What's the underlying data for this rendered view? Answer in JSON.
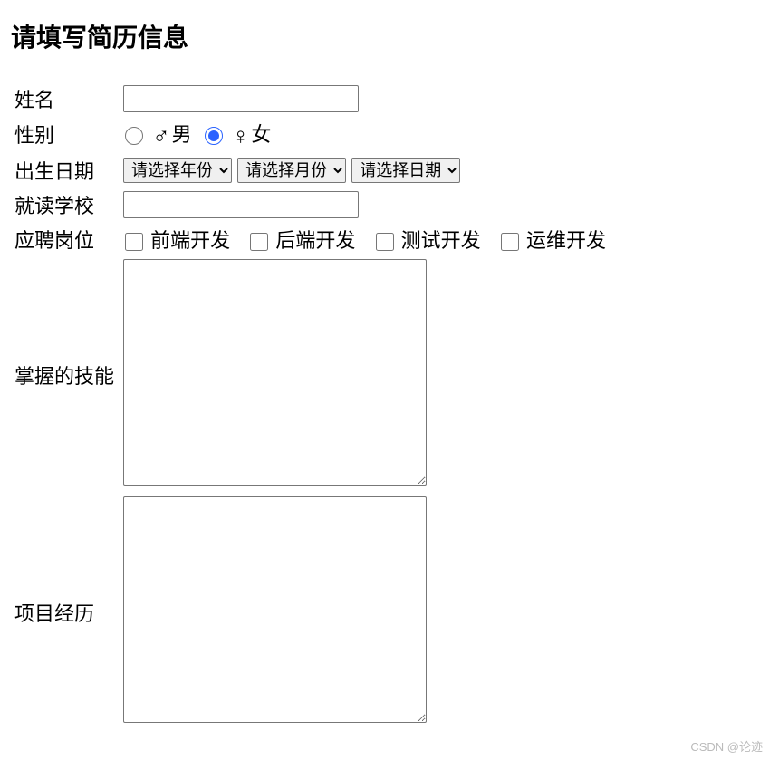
{
  "title": "请填写简历信息",
  "fields": {
    "name": {
      "label": "姓名",
      "value": ""
    },
    "gender": {
      "label": "性别",
      "options": [
        {
          "symbol": "♂",
          "text": "男",
          "checked": false
        },
        {
          "symbol": "♀",
          "text": "女",
          "checked": true
        }
      ]
    },
    "birth": {
      "label": "出生日期",
      "year": {
        "placeholder": "请选择年份"
      },
      "month": {
        "placeholder": "请选择月份"
      },
      "day": {
        "placeholder": "请选择日期"
      }
    },
    "school": {
      "label": "就读学校",
      "value": ""
    },
    "position": {
      "label": "应聘岗位",
      "options": [
        {
          "text": "前端开发",
          "checked": false
        },
        {
          "text": "后端开发",
          "checked": false
        },
        {
          "text": "测试开发",
          "checked": false
        },
        {
          "text": "运维开发",
          "checked": false
        }
      ]
    },
    "skills": {
      "label": "掌握的技能",
      "value": ""
    },
    "projects": {
      "label": "项目经历",
      "value": ""
    }
  },
  "watermark": "CSDN @论迹"
}
